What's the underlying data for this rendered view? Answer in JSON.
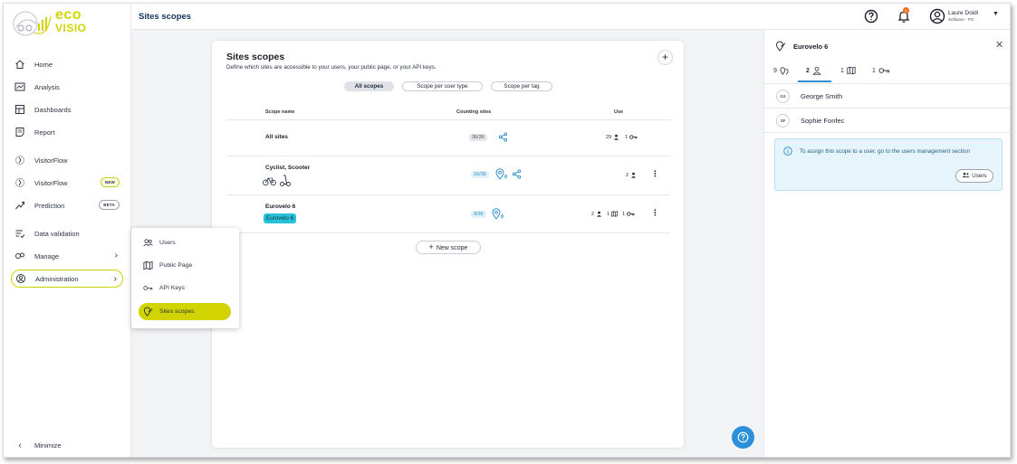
{
  "app": {
    "logo_text_top": "eco",
    "logo_text_bottom": "VISIO",
    "page_title": "Sites scopes"
  },
  "sidebar": {
    "items": [
      {
        "label": "Home",
        "icon": "home-icon"
      },
      {
        "label": "Analysis",
        "icon": "analysis-icon"
      },
      {
        "label": "Dashboards",
        "icon": "dashboard-icon"
      },
      {
        "label": "Report",
        "icon": "report-icon"
      },
      {
        "label": "VisitorFlow",
        "icon": "visitorflow-icon"
      },
      {
        "label": "VisitorFlow",
        "icon": "visitorflow-icon",
        "badge": "NEW"
      },
      {
        "label": "Prediction",
        "icon": "prediction-icon",
        "badge": "BETA"
      },
      {
        "label": "Data validation",
        "icon": "data-validation-icon"
      },
      {
        "label": "Manage",
        "icon": "manage-icon"
      },
      {
        "label": "Administration",
        "icon": "administration-icon"
      }
    ],
    "minimize_label": "Minimize"
  },
  "topbar": {
    "notification_count": "6",
    "user_name": "Laure Doidi",
    "user_role": "Software - PO"
  },
  "card": {
    "title": "Sites scopes",
    "subtitle": "Define which sites are accessible to your users, your public page, or your API keys.",
    "filters": [
      "All scopes",
      "Scope per user type",
      "Scope per tag"
    ],
    "columns": {
      "name": "Scope name",
      "sites": "Counting sites",
      "use": "Use"
    },
    "rows": [
      {
        "name": "All sites",
        "counting": "36/36",
        "use_users": "29",
        "use_keys": "1"
      },
      {
        "name": "Cyclist, Scooter",
        "counting": "16/36",
        "use_users": "2"
      },
      {
        "name": "Eurovelo 6",
        "tag": "Eurovelo 6",
        "counting": "9/36",
        "use_users": "2",
        "use_pages": "1",
        "use_keys": "1"
      }
    ],
    "new_scope_label": "New scope"
  },
  "popup": {
    "items": [
      {
        "label": "Users",
        "icon": "users-icon"
      },
      {
        "label": "Public Page",
        "icon": "public-page-icon"
      },
      {
        "label": "API Keys",
        "icon": "api-key-icon"
      },
      {
        "label": "Sites scopes",
        "icon": "sites-scope-icon"
      }
    ]
  },
  "panel": {
    "title": "Eurovelo 6",
    "tabs": [
      {
        "count": "9",
        "icon": "sites-icon"
      },
      {
        "count": "2",
        "icon": "user-icon"
      },
      {
        "count": "1",
        "icon": "map-icon"
      },
      {
        "count": "1",
        "icon": "key-icon"
      }
    ],
    "users": [
      {
        "initials": "GS",
        "name": "George Smith"
      },
      {
        "initials": "SF",
        "name": "Sophie Fonfec"
      }
    ],
    "info_text": "To assign this scope to a user, go to the users management section",
    "users_button": "Users"
  },
  "colors": {
    "accent_lime": "#d1d400",
    "accent_blue": "#2b90d9",
    "title_navy": "#16325c",
    "tag_cyan": "#27c2d9",
    "notification_orange": "#ef6c1a"
  }
}
